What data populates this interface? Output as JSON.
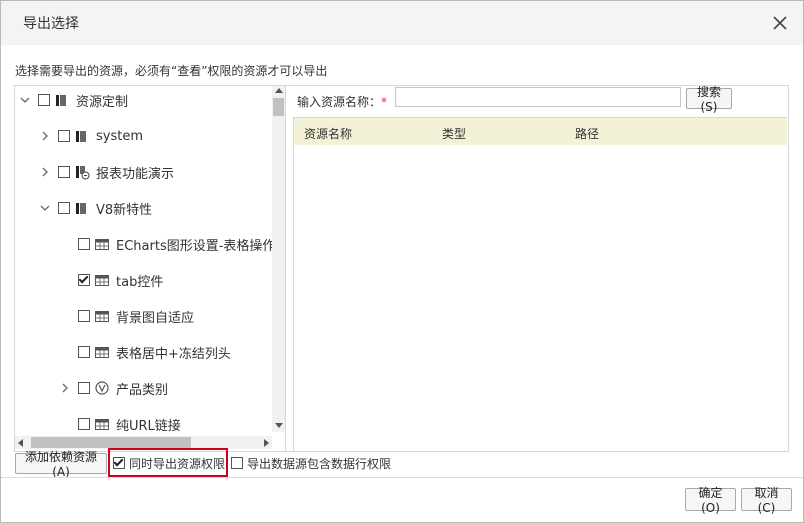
{
  "dialog": {
    "title": "导出选择",
    "hint": "选择需要导出的资源，必须有“查看”权限的资源才可以导出"
  },
  "tree": {
    "items": [
      {
        "label": "资源定制",
        "expander": "expanded",
        "checked": false,
        "icon": "folder-icon"
      },
      {
        "label": "system",
        "expander": "collapsed",
        "checked": false,
        "icon": "folder-icon"
      },
      {
        "label": "报表功能演示",
        "expander": "collapsed",
        "checked": false,
        "icon": "report-folder-icon"
      },
      {
        "label": "V8新特性",
        "expander": "expanded",
        "checked": false,
        "icon": "folder-icon"
      },
      {
        "label": "ECharts图形设置-表格操作",
        "expander": "none",
        "checked": false,
        "icon": "spreadsheet-icon"
      },
      {
        "label": "tab控件",
        "expander": "none",
        "checked": true,
        "icon": "spreadsheet-icon"
      },
      {
        "label": "背景图自适应",
        "expander": "none",
        "checked": false,
        "icon": "spreadsheet-icon"
      },
      {
        "label": "表格居中+冻结列头",
        "expander": "none",
        "checked": false,
        "icon": "spreadsheet-icon"
      },
      {
        "label": "产品类别",
        "expander": "collapsed",
        "checked": false,
        "icon": "query-icon"
      },
      {
        "label": "纯URL链接",
        "expander": "none",
        "checked": false,
        "icon": "spreadsheet-icon"
      }
    ]
  },
  "search": {
    "label": "输入资源名称：",
    "required_mark": "*",
    "value": "",
    "button_label": "搜索(S)"
  },
  "results": {
    "columns": [
      "资源名称",
      "类型",
      "路径"
    ]
  },
  "footer": {
    "add_dependency_label": "添加依赖资源(A)",
    "export_permission_label": "同时导出资源权限",
    "export_permission_checked": true,
    "export_row_permission_label": "导出数据源包含数据行权限",
    "export_row_permission_checked": false
  },
  "buttons": {
    "ok_label": "确定(O)",
    "cancel_label": "取消(C)"
  },
  "colors": {
    "results_header_bg": "#f3f1d6",
    "highlight_border": "#d0021b",
    "required_mark": "#e03030"
  }
}
